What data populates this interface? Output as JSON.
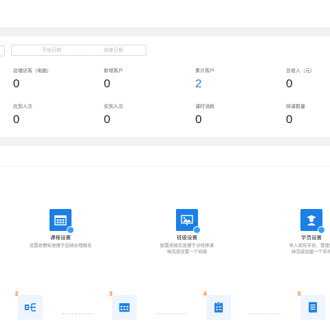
{
  "filter": {
    "start_placeholder": "开始日期",
    "separator": "-",
    "end_placeholder": "结束日期"
  },
  "stats": [
    {
      "label": "店铺访客（电脑）",
      "value": "0"
    },
    {
      "label": "新增客户",
      "value": "0"
    },
    {
      "label": "累计客户",
      "value": "2"
    },
    {
      "label": "总收入（元）",
      "value": "0"
    },
    {
      "label": "应到人次",
      "value": "0"
    },
    {
      "label": "实到人次",
      "value": "0"
    },
    {
      "label": "课时消耗",
      "value": "0"
    },
    {
      "label": "排课数量",
      "value": "0"
    }
  ],
  "setup_cards": [
    {
      "title": "课程设置",
      "desc_lines": [
        "设置收费标准便于后续办理报名"
      ],
      "icon": "calendar-grid-icon"
    },
    {
      "title": "班级设置",
      "desc_lines": [
        "配置班级信息便于分班排课",
        "待完成设置一个班级"
      ],
      "icon": "classroom-board-icon"
    },
    {
      "title": "学员设置",
      "desc_lines": [
        "导入现有学员、管理学",
        "待完成创建一个学员"
      ],
      "icon": "student-icon"
    }
  ],
  "steps": [
    {
      "num": "2",
      "icon": "org-chart-icon"
    },
    {
      "num": "3",
      "icon": "calendar-icon"
    },
    {
      "num": "4",
      "icon": "checklist-icon"
    },
    {
      "num": "5",
      "icon": "document-icon"
    }
  ],
  "colors": {
    "accent": "#3a7bd5",
    "tile": "#1c7fe6",
    "step_number": "#f5822a",
    "page_bg": "#f0f2f5"
  }
}
